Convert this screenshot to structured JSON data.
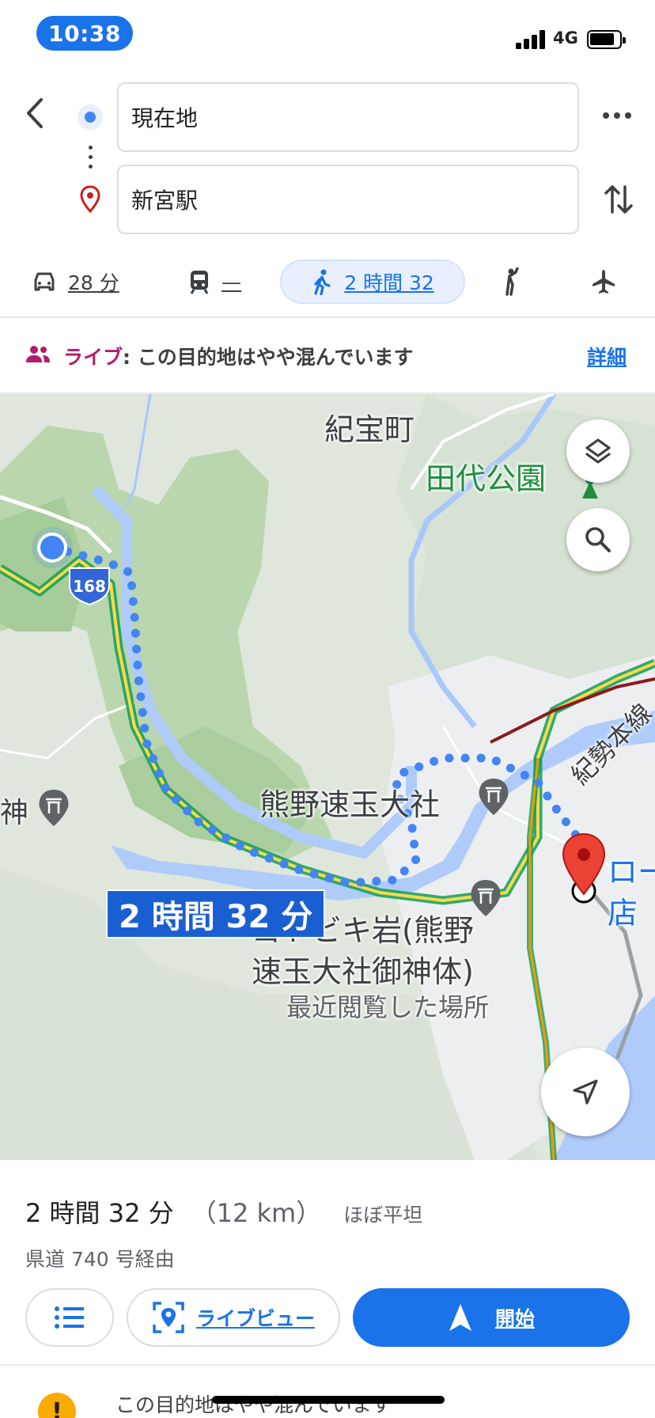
{
  "status_bar": {
    "time": "10:38",
    "network": "4G"
  },
  "directions": {
    "origin": "現在地",
    "destination": "新宮駅"
  },
  "modes": {
    "drive": "28 分",
    "transit": "—",
    "walk": "2 時間 32",
    "selected": "walk"
  },
  "live_banner": {
    "tag": "ライブ",
    "message": ": この目的地はやや混んでいます",
    "details_link": "詳細"
  },
  "map": {
    "place_labels": {
      "town": "紀宝町",
      "park": "田代公園",
      "shrine": "熊野速玉大社",
      "gotobiki_line1": "ゴトビキ岩(熊野",
      "gotobiki_line2": "速玉大社御神体)",
      "recent": "最近閲覧した場所",
      "left_shrine": "神",
      "rail_line": "紀勢本線",
      "station_line1": "ロー",
      "station_line2": "店",
      "route_shield": "168"
    },
    "route_time_label": "2 時間 32 分"
  },
  "summary": {
    "duration": "2 時間 32 分",
    "distance": "（12 km）",
    "terrain": "ほぼ平坦",
    "via": "県道 740 号経由"
  },
  "actions": {
    "live_view": "ライブビュー",
    "start": "開始"
  },
  "notice": {
    "icon_text": "!",
    "text": "この目的地はやや混んでいます"
  },
  "colors": {
    "accent": "#1a73e8",
    "route_dots": "#4285f4",
    "destination_pin": "#ea4335",
    "live_tag": "#b31c6b",
    "warning": "#f9ab00"
  }
}
